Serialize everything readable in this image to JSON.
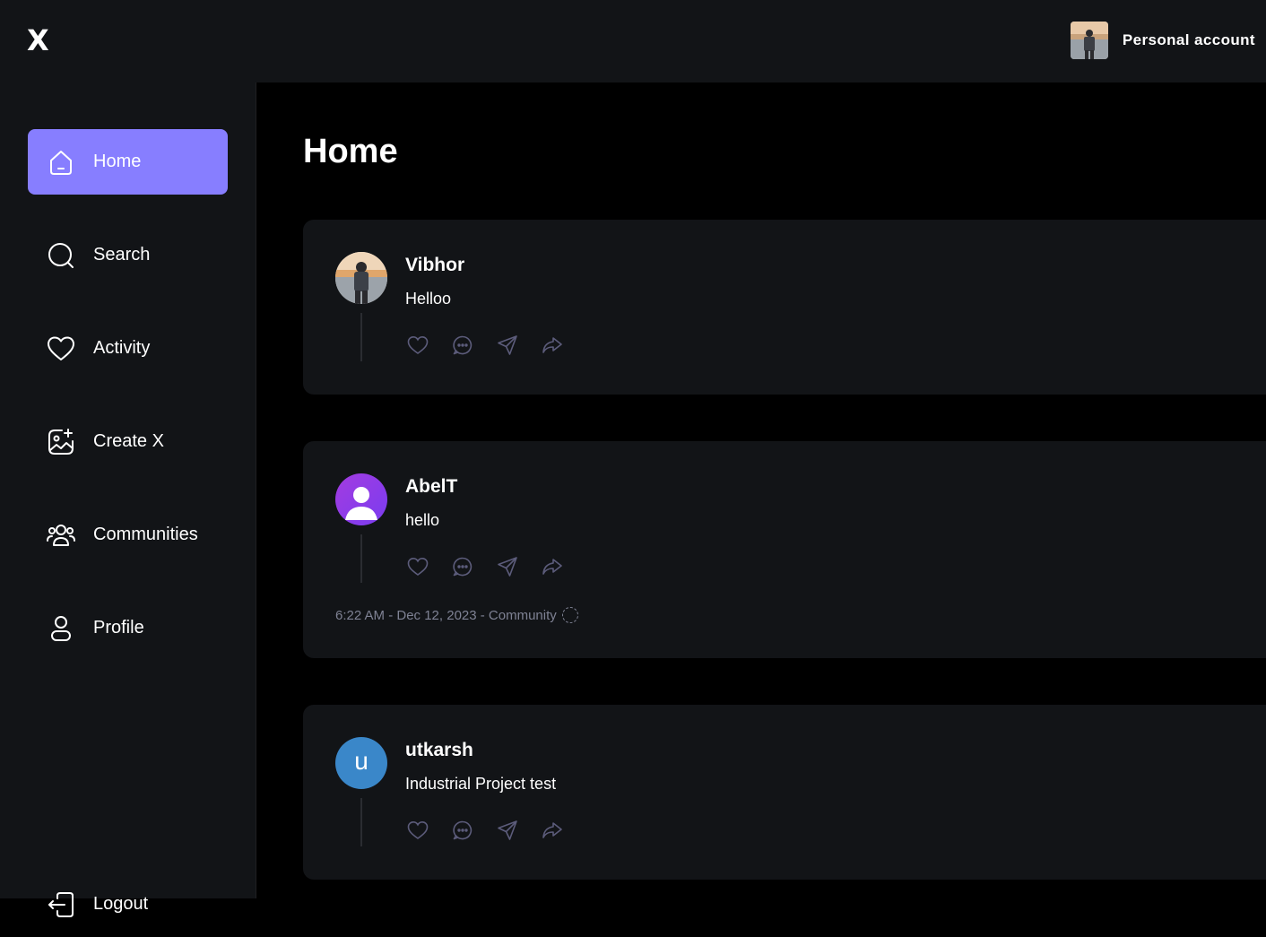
{
  "app": {
    "logo": "X"
  },
  "account": {
    "label": "Personal account"
  },
  "sidebar": {
    "items": [
      {
        "label": "Home",
        "icon": "home-icon",
        "active": true
      },
      {
        "label": "Search",
        "icon": "search-icon"
      },
      {
        "label": "Activity",
        "icon": "heart-icon"
      },
      {
        "label": "Create X",
        "icon": "gallery-add-icon"
      },
      {
        "label": "Communities",
        "icon": "users-icon"
      },
      {
        "label": "Profile",
        "icon": "user-icon"
      }
    ],
    "logout": "Logout"
  },
  "main": {
    "title": "Home"
  },
  "posts": [
    {
      "author": "Vibhor",
      "text": "Helloo",
      "avatar": "photo"
    },
    {
      "author": "AbelT",
      "text": "hello",
      "avatar": "default-user",
      "meta": "6:22 AM - Dec 12, 2023 - Community"
    },
    {
      "author": "utkarsh",
      "text": "Industrial Project test",
      "avatar": "letter",
      "avatar_letter": "u"
    }
  ],
  "colors": {
    "accent": "#877eff",
    "surface": "#121417",
    "background": "#000000",
    "meta": "#7f8294"
  }
}
